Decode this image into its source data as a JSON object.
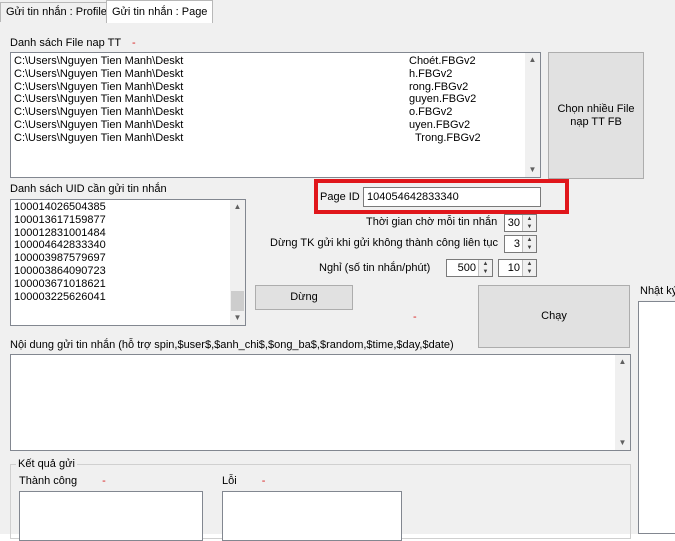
{
  "tabs": [
    {
      "label": "Gửi tin nhắn : Profile"
    },
    {
      "label": "Gửi tin nhắn : Page"
    }
  ],
  "file_list": {
    "label": "Danh sách File nap TT",
    "marker": "-",
    "left_items": [
      "C:\\Users\\Nguyen Tien Manh\\Deskt",
      "C:\\Users\\Nguyen Tien Manh\\Deskt",
      "C:\\Users\\Nguyen Tien Manh\\Deskt",
      "C:\\Users\\Nguyen Tien Manh\\Deskt",
      "C:\\Users\\Nguyen Tien Manh\\Deskt",
      "C:\\Users\\Nguyen Tien Manh\\Deskt",
      "C:\\Users\\Nguyen Tien Manh\\Deskt"
    ],
    "right_items": [
      "Choét.FBGv2",
      "h.FBGv2",
      "rong.FBGv2",
      "guyen.FBGv2",
      "o.FBGv2",
      "uyen.FBGv2",
      "Trong.FBGv2"
    ]
  },
  "choose_files_button": "Chọn nhiều File nạp TT FB",
  "uid_list": {
    "label": "Danh sách UID cần gửi tin nhắn",
    "items": [
      "100014026504385",
      "100013617159877",
      "100012831001484",
      "100004642833340",
      "100003987579697",
      "100003864090723",
      "100003671018621",
      "100003225626041"
    ]
  },
  "page_id": {
    "label": "Page ID",
    "value": "104054642833340"
  },
  "wait_time": {
    "label": "Thời gian chờ mỗi tin nhắn",
    "value": "30"
  },
  "stop_fail": {
    "label": "Dừng TK gửi khi gửi không thành công liên tục",
    "value": "3"
  },
  "rest": {
    "label": "Nghỉ (số tin nhắn/phút)",
    "value1": "500",
    "value2": "10"
  },
  "stop_button": "Dừng",
  "stop_marker": "-",
  "run_button": "Chạy",
  "log_label": "Nhật ký",
  "message": {
    "label": "Nội dung gửi tin nhắn (hỗ trợ spin,$user$,$anh_chi$,$ong_ba$,$random,$time,$day,$date)",
    "value": ""
  },
  "results": {
    "group_label": "Kết quả gửi",
    "success_label": "Thành công",
    "success_marker": "-",
    "error_label": "Lỗi",
    "error_marker": "-"
  }
}
